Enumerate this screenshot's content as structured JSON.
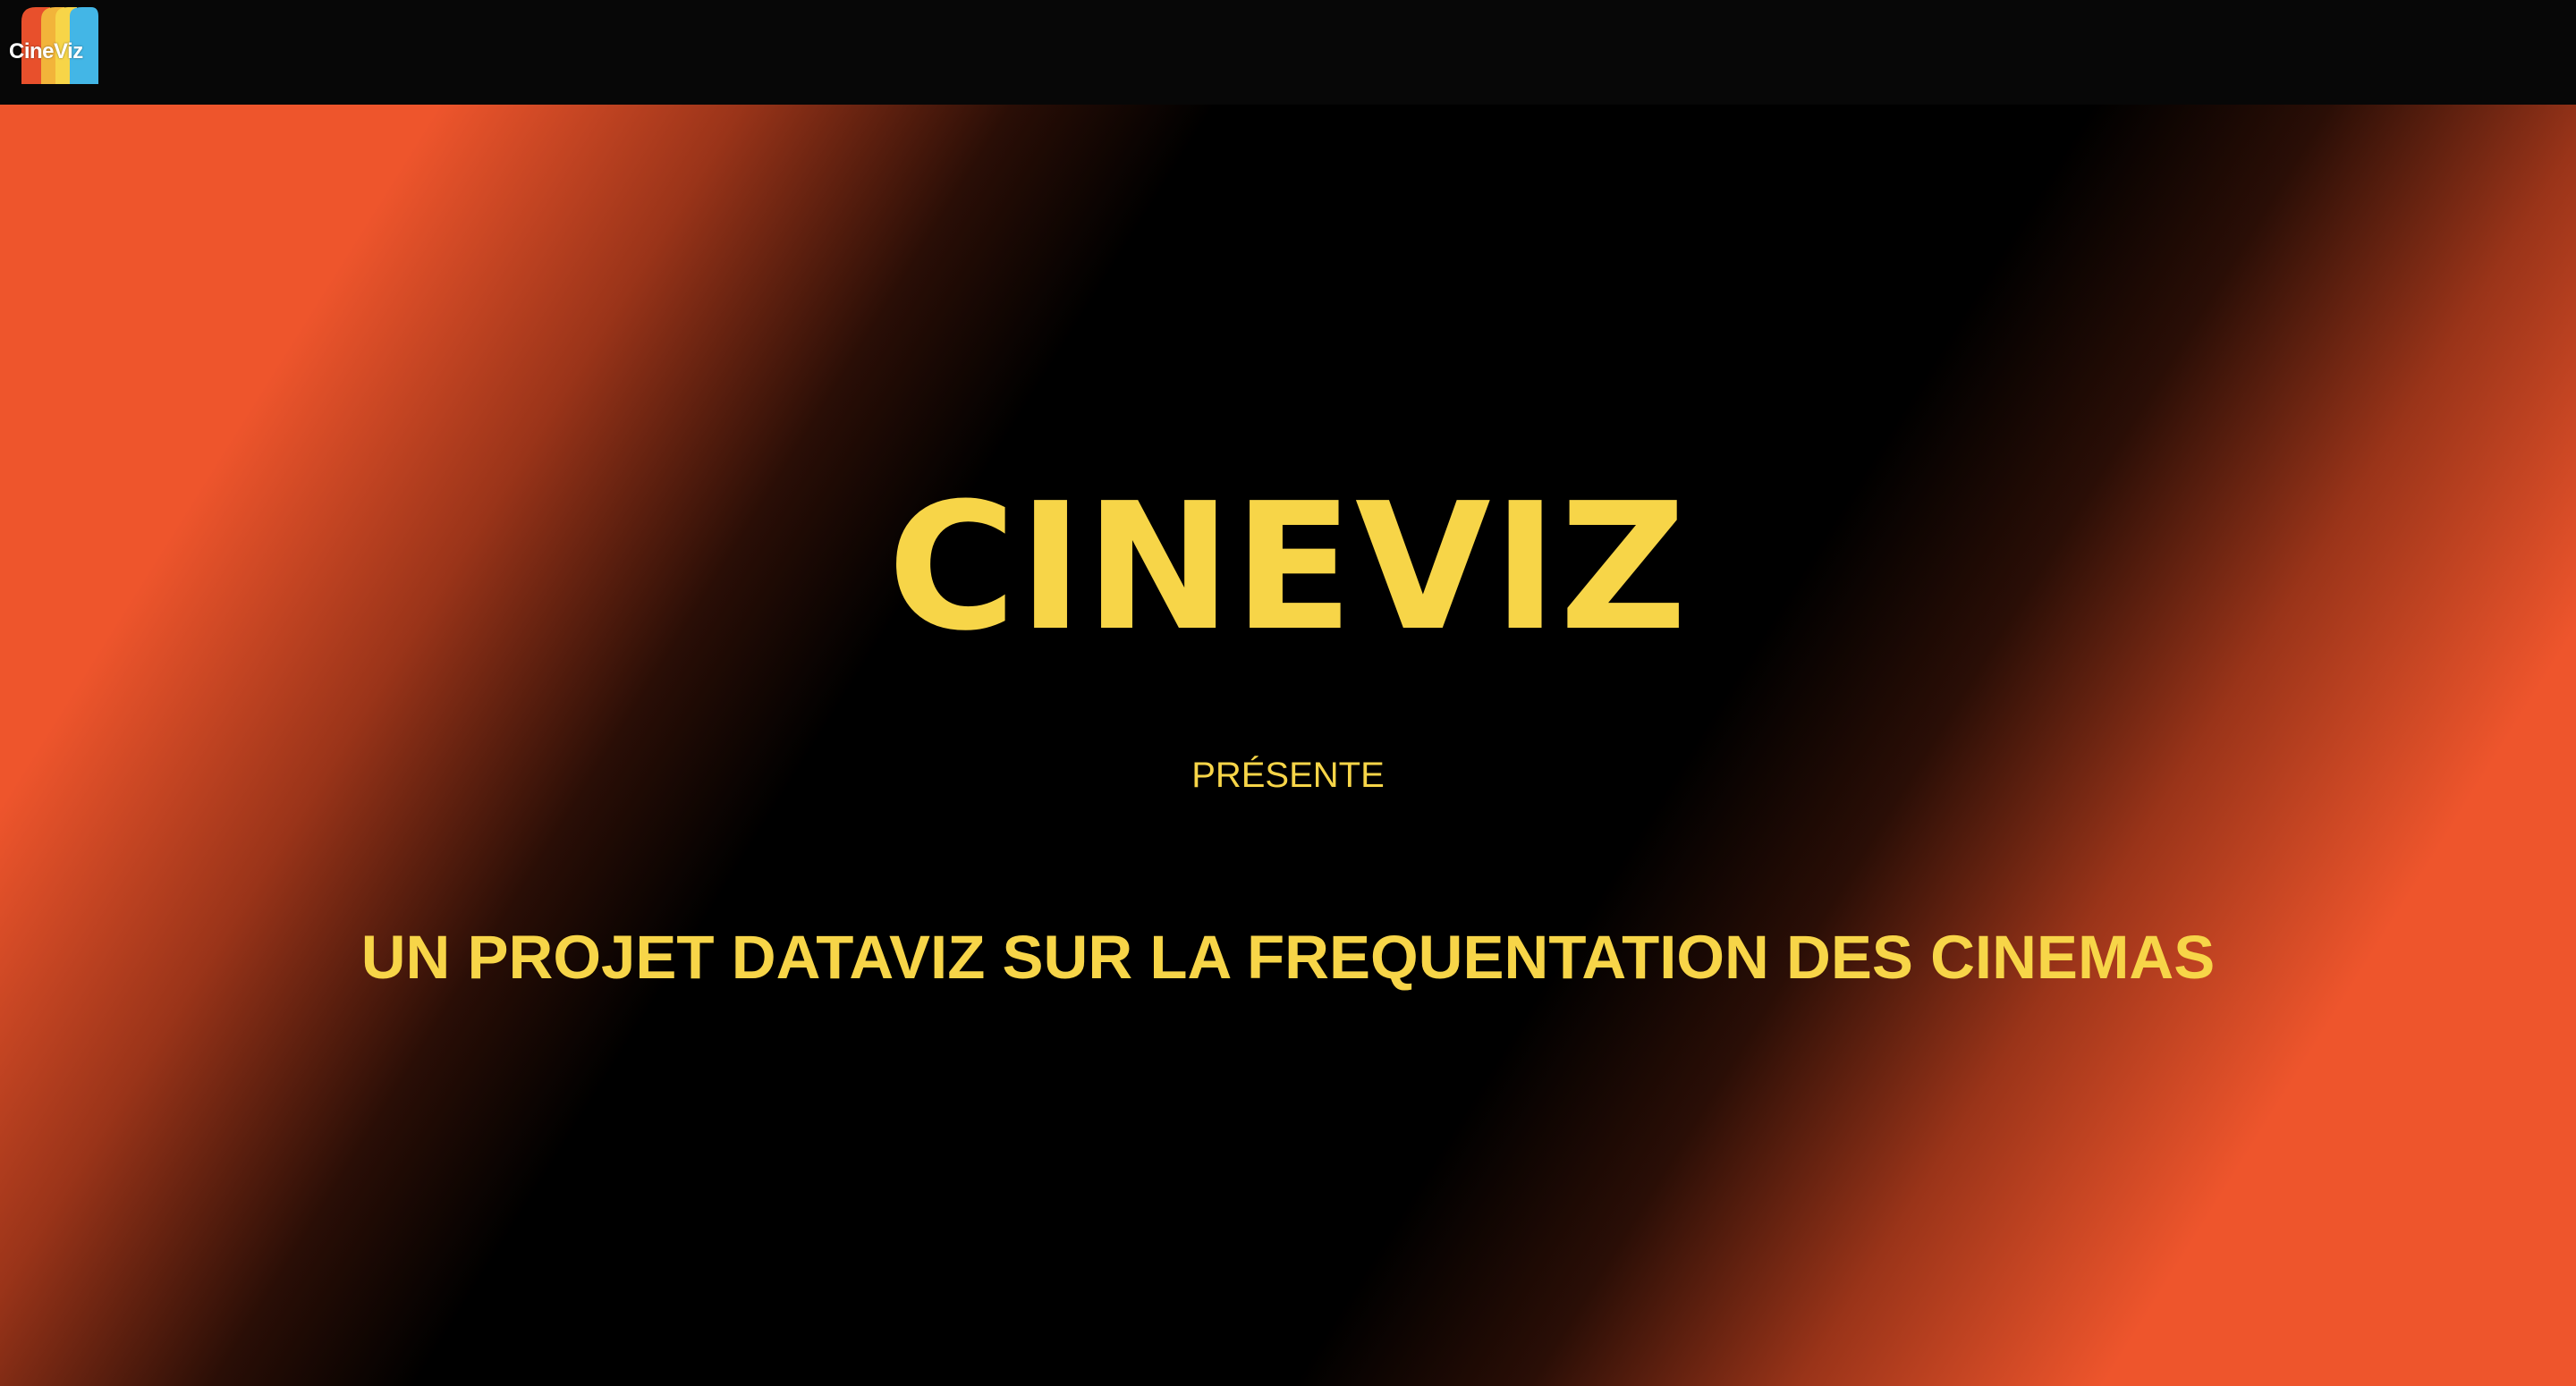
{
  "header": {
    "logo": {
      "text": "CineViz",
      "stripe_colors": [
        "#e8502c",
        "#f2b43a",
        "#f7d548",
        "#43b6e6"
      ]
    }
  },
  "hero": {
    "title": "CINEVIZ",
    "kicker": "PRÉSENTE",
    "subtitle": "UN PROJET DATAVIZ SUR LA FREQUENTATION DES CINEMAS"
  },
  "colors": {
    "accent_yellow": "#f7d548",
    "accent_orange": "#ee552c",
    "background": "#000000",
    "topbar": "#070707"
  }
}
